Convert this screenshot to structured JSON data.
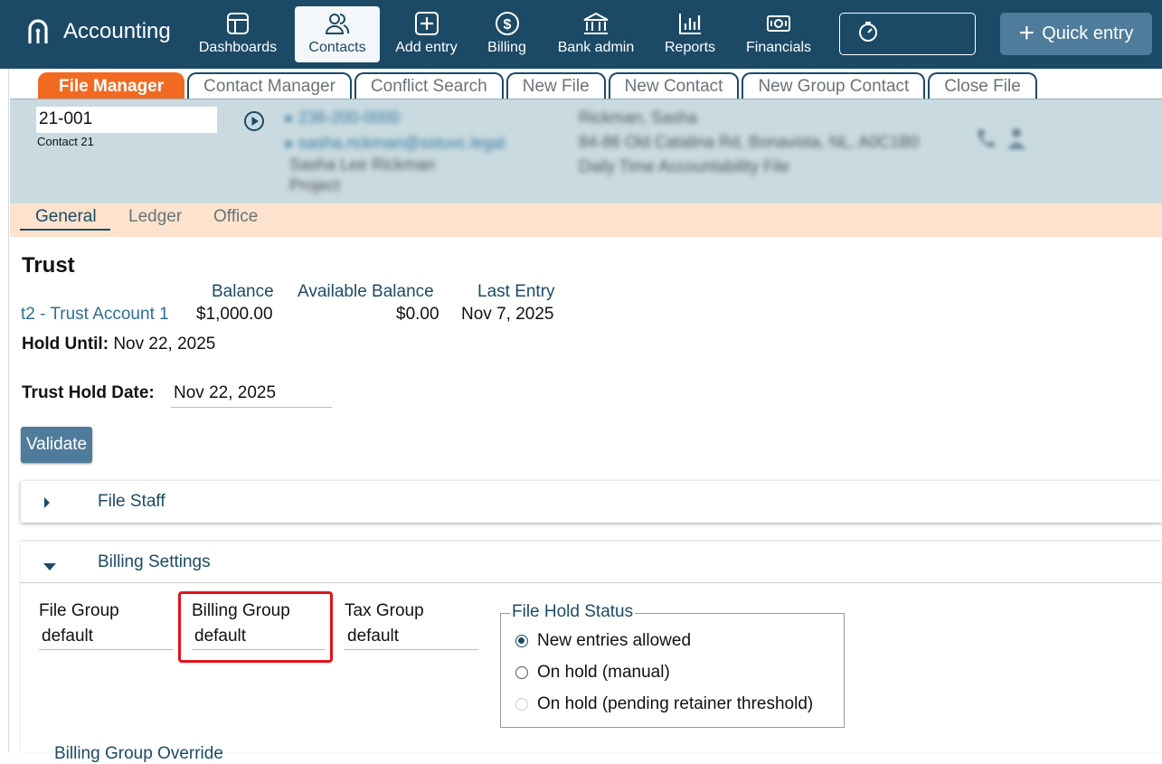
{
  "app": {
    "name": "Accounting"
  },
  "nav": [
    {
      "label": "Dashboards",
      "icon": "dashboard-icon"
    },
    {
      "label": "Contacts",
      "icon": "contacts-icon",
      "active": true
    },
    {
      "label": "Add entry",
      "icon": "plus-square-icon"
    },
    {
      "label": "Billing",
      "icon": "dollar-icon"
    },
    {
      "label": "Bank admin",
      "icon": "bank-icon"
    },
    {
      "label": "Reports",
      "icon": "bar-chart-icon"
    },
    {
      "label": "Financials",
      "icon": "money-icon"
    }
  ],
  "timer": {
    "icon": "stopwatch-icon",
    "value": ""
  },
  "quick_entry": {
    "label": "Quick entry"
  },
  "subtabs": [
    "File Manager",
    "Contact Manager",
    "Conflict Search",
    "New File",
    "New Contact",
    "New Group Contact",
    "Close File"
  ],
  "file": {
    "number": "21-001",
    "contact": "Contact 21",
    "phone": "236-200-0000",
    "email": "sasha.rickman@sstuvc.legal",
    "line1": "Sasha Lee Rickman",
    "line2": "Project",
    "name": "Rickman, Sasha",
    "address": "84-86 Old Catalina Rd, Bonavista, NL, A0C1B0",
    "description": "Daily Time Accountability File"
  },
  "general_tabs": [
    "General",
    "Ledger",
    "Office"
  ],
  "trust": {
    "title": "Trust",
    "headers": {
      "balance": "Balance",
      "available": "Available Balance",
      "last_entry": "Last Entry"
    },
    "account": "t2 - Trust Account 1",
    "balance": "$1,000.00",
    "available": "$0.00",
    "last_entry": "Nov 7, 2025",
    "hold_until_label": "Hold Until:",
    "hold_until_value": "Nov 22, 2025",
    "hold_date_label": "Trust Hold Date:",
    "hold_date_value": "Nov 22, 2025",
    "validate_label": "Validate"
  },
  "file_staff": {
    "title": "File Staff"
  },
  "billing": {
    "title": "Billing Settings",
    "file_group_label": "File Group",
    "file_group_value": "default",
    "billing_group_label": "Billing Group",
    "billing_group_value": "default",
    "tax_group_label": "Tax Group",
    "tax_group_value": "default",
    "hold_status_label": "File Hold Status",
    "hold_options": [
      "New entries allowed",
      "On hold (manual)",
      "On hold (pending retainer threshold)"
    ],
    "hold_selected": 0,
    "cutoff_text": "Billing Group Override"
  }
}
